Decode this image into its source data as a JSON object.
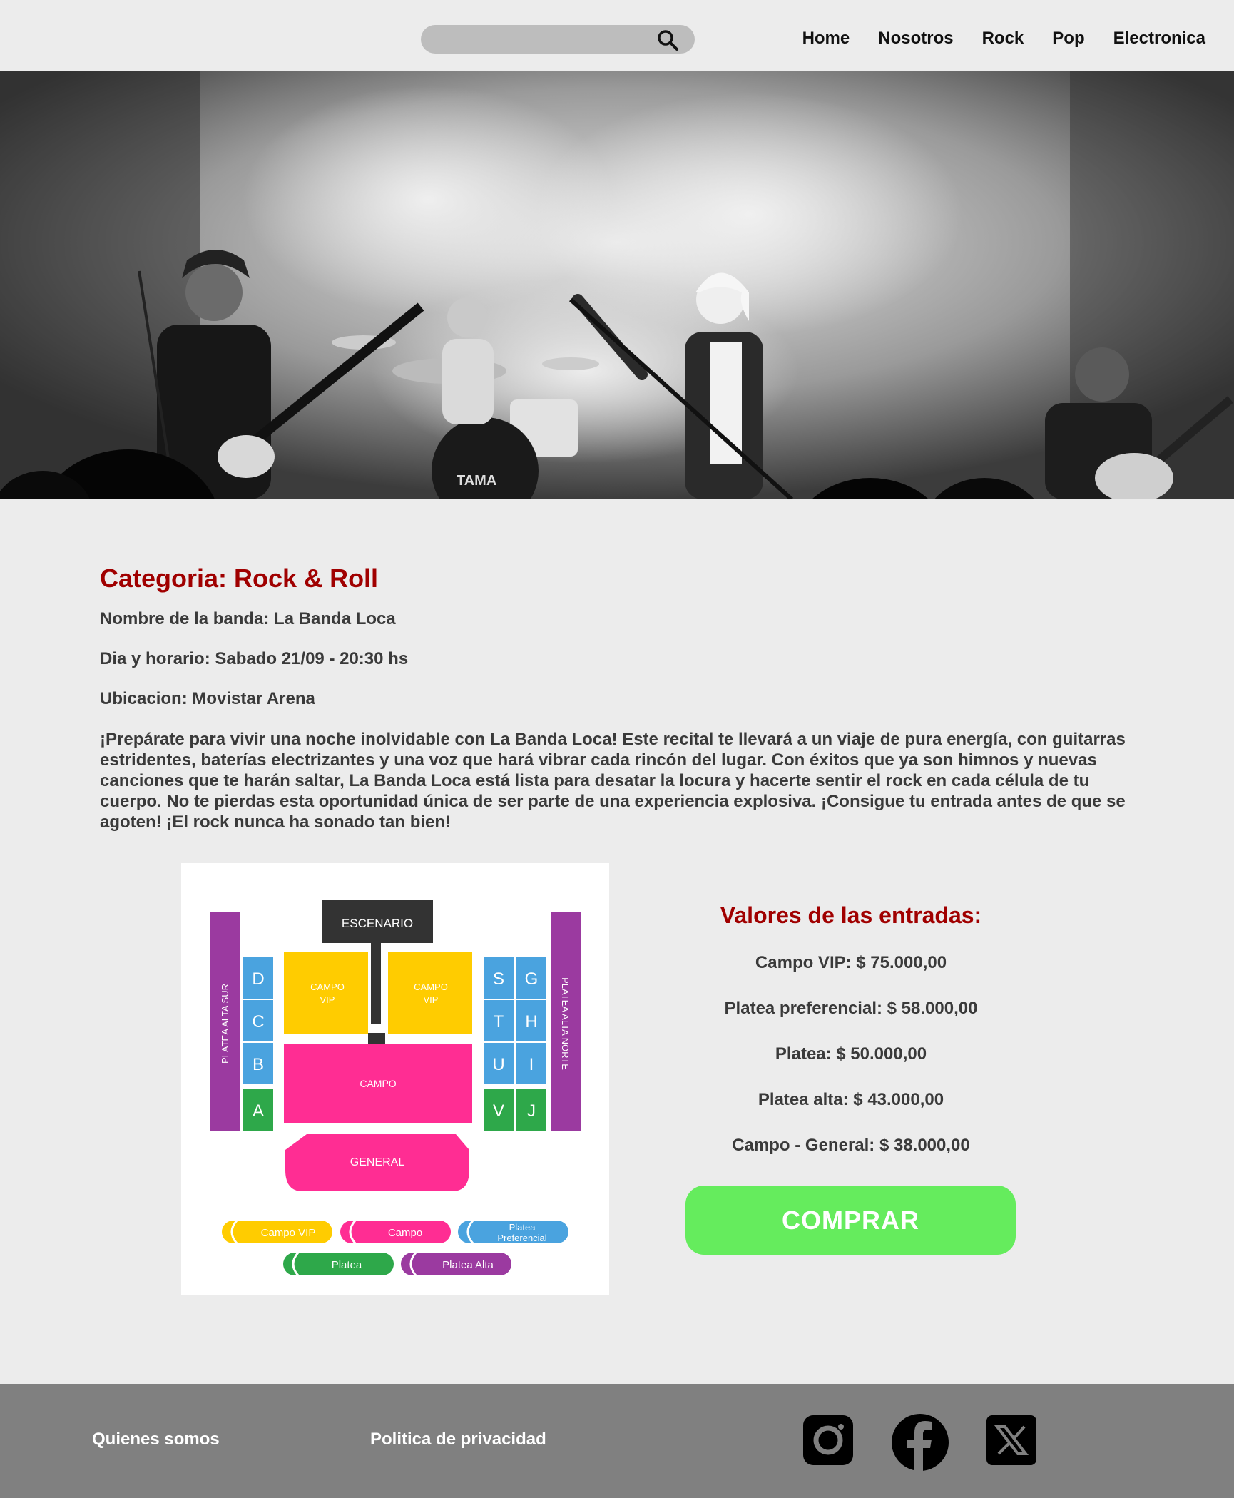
{
  "search": {
    "placeholder": ""
  },
  "nav": {
    "home": "Home",
    "nosotros": "Nosotros",
    "rock": "Rock",
    "pop": "Pop",
    "electronica": "Electronica"
  },
  "event": {
    "category": "Categoria: Rock & Roll",
    "band": "Nombre de la banda: La Banda Loca",
    "datetime": "Dia y horario: Sabado 21/09 - 20:30 hs",
    "location": "Ubicacion: Movistar Arena",
    "description": "¡Prepárate para vivir una noche inolvidable con La Banda Loca! Este recital te llevará a un viaje de pura energía, con guitarras estridentes, baterías electrizantes y una voz que hará vibrar cada rincón del lugar. Con éxitos que ya son himnos y nuevas canciones que te harán saltar, La Banda Loca está lista para desatar la locura y hacerte sentir el rock en cada célula de tu cuerpo. No te pierdas esta oportunidad única de ser parte de una experiencia explosiva. ¡Consigue tu entrada antes de que se agoten! ¡El rock nunca ha sonado tan bien!"
  },
  "seat_map": {
    "stage": "ESCENARIO",
    "platea_sur": "PLATEA ALTA SUR",
    "platea_norte": "PLATEA ALTA NORTE",
    "campo_vip": "CAMPO",
    "campo_vip_2": "VIP",
    "campo": "CAMPO",
    "general": "GENERAL",
    "left_blocks": [
      "D",
      "C",
      "B",
      "A"
    ],
    "right_inner": [
      "S",
      "T",
      "U",
      "V"
    ],
    "right_outer": [
      "G",
      "H",
      "I",
      "J"
    ],
    "legend": {
      "campo_vip": "Campo VIP",
      "campo": "Campo",
      "platea_pref_1": "Platea",
      "platea_pref_2": "Preferencial",
      "platea": "Platea",
      "platea_alta": "Platea Alta"
    },
    "colors": {
      "vip": "#ffcc00",
      "campo": "#ff2d93",
      "preferencial": "#4aa3df",
      "platea": "#2ea84a",
      "alta": "#9b3aa0",
      "stage": "#333333"
    }
  },
  "prices": {
    "title": "Valores de las entradas:",
    "items": [
      "Campo VIP: $ 75.000,00",
      "Platea preferencial: $ 58.000,00",
      "Platea: $ 50.000,00",
      "Platea alta: $ 43.000,00",
      "Campo - General: $ 38.000,00"
    ]
  },
  "buy_button": "COMPRAR",
  "footer": {
    "about": "Quienes somos",
    "privacy": "Politica de privacidad",
    "icons": [
      "instagram-icon",
      "facebook-icon",
      "x-icon"
    ]
  }
}
